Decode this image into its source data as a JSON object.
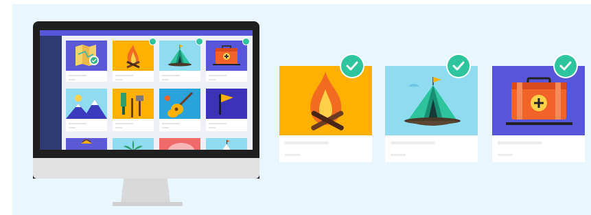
{
  "illustration": {
    "monitor": {
      "tiles": [
        {
          "name": "map",
          "bg": "#5b59d6",
          "selected": false
        },
        {
          "name": "campfire",
          "bg": "#ffb000",
          "selected": true
        },
        {
          "name": "tent",
          "bg": "#8fdcf1",
          "selected": true
        },
        {
          "name": "first-aid-kit",
          "bg": "#5755d9",
          "selected": true
        },
        {
          "name": "mountains",
          "bg": "#8fdcf1",
          "selected": false
        },
        {
          "name": "tools",
          "bg": "#ffb000",
          "selected": false
        },
        {
          "name": "guitar",
          "bg": "#2aa3da",
          "selected": false
        },
        {
          "name": "flag",
          "bg": "#3b32b8",
          "selected": false
        },
        {
          "name": "lantern",
          "bg": "#5b59d6",
          "selected": false
        },
        {
          "name": "plant",
          "bg": "#8fdcf1",
          "selected": false
        },
        {
          "name": "pig",
          "bg": "#f06a6a",
          "selected": false
        },
        {
          "name": "snowy-peak",
          "bg": "#8fdcf1",
          "selected": false
        }
      ]
    },
    "selected_cards": [
      {
        "name": "campfire",
        "bg": "#ffb000",
        "selected": true
      },
      {
        "name": "tent",
        "bg": "#8fdcf1",
        "selected": true
      },
      {
        "name": "first-aid-kit",
        "bg": "#5755d9",
        "selected": true
      }
    ],
    "colors": {
      "background": "#e9f6fd",
      "check": "#2ec49e",
      "accent": "#5755d9"
    }
  }
}
